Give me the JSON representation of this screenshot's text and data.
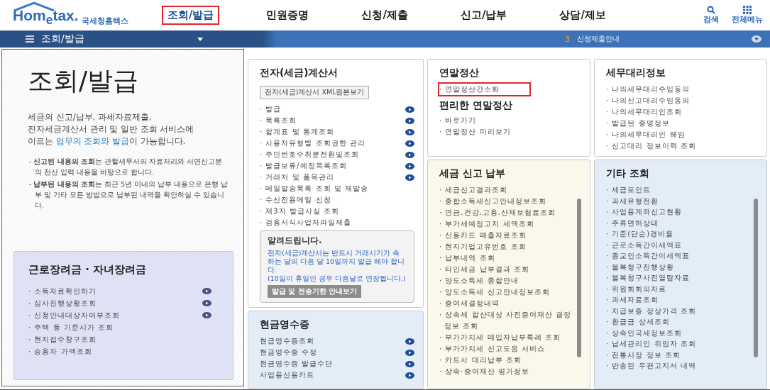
{
  "header": {
    "logo": "Hom$_{e}$tax.",
    "brand": "국세청홈택스",
    "nav": [
      {
        "label": "조회/발급",
        "selected": true
      },
      {
        "label": "민원증명",
        "selected": false
      },
      {
        "label": "신청/제출",
        "selected": false
      },
      {
        "label": "신고/납부",
        "selected": false
      },
      {
        "label": "상담/제보",
        "selected": false
      }
    ],
    "tools": [
      {
        "kind": "search",
        "label": "검색"
      },
      {
        "kind": "menu",
        "label": "전체메뉴"
      }
    ]
  },
  "subbar": {
    "title": "조회/발급",
    "count": "3",
    "notice": "신청제출안내"
  },
  "intro": {
    "title": "조회/발급",
    "before": "세금의 신고/납부, 과세자료제출,\n전자세금계산서 관리 및 일반 조회 서비스에\n이르는 ",
    "highlight": "업무의 조회와 발급",
    "after": "이 가능합니다.",
    "notes": [
      "- **신고된 내용의 조회**는 관할세무서의 자료처리와 서면신고분의 전산 입력 내용을 바탕으로 합니다.",
      "- **납부된 내용의 조회**는 최근 5년 이내의 납부 내용으로 은행 납부 및 기타 모든 방법으로 납부된 내역을 확인하실 수 있습니다."
    ]
  },
  "incentive": {
    "title": "근로장려금 · 자녀장려금",
    "items": [
      {
        "label": "· 소득자료확인하기",
        "arrow": true
      },
      {
        "label": "· 심사진행상황조회",
        "arrow": true
      },
      {
        "label": "· 신청안내대상자여부조회",
        "arrow": true
      },
      {
        "label": "· 주택 등 기준시가 조회",
        "arrow": false
      },
      {
        "label": "· 현지접수창구조회",
        "arrow": false
      },
      {
        "label": "· 승용차 가액조회",
        "arrow": false
      }
    ]
  },
  "einvoice": {
    "title": "전자(세금)계산서",
    "xml_button": "전자(세금)계산서 XML원본보기",
    "items": [
      {
        "label": "· 발급",
        "arrow": true
      },
      {
        "label": "· 목록조회",
        "arrow": true
      },
      {
        "label": "· 합계표 및 통계조회",
        "arrow": true
      },
      {
        "label": "· 사용자유형별 조회권한 관리",
        "arrow": true
      },
      {
        "label": "· 주민번호수취분전환및조회",
        "arrow": true
      },
      {
        "label": "· 발급보류/예정목록조회",
        "arrow": true
      },
      {
        "label": "· 거래처 및 품목관리",
        "arrow": true
      },
      {
        "label": "· 메일발송목록 조회 및 재발송",
        "arrow": false
      },
      {
        "label": "· 수신전용메일 신청",
        "arrow": false
      },
      {
        "label": "· 제3자 발급사실 조회",
        "arrow": false
      },
      {
        "label": "· 검용서식사업자파일제출",
        "arrow": false
      }
    ],
    "notice": {
      "title": "알려드립니다.",
      "body": "전자(세금)계산서는 반드시 거래시기가 속하는 달의 다음 달 10일까지 발급 해야 합니다.",
      "note": "(10일이 휴일인 경우 다음날로 연장됩니다.)",
      "button": "발급 및 전송기한 안내보기"
    }
  },
  "cash_receipt": {
    "title": "현금영수증",
    "items": [
      {
        "label": "현금영수증조회",
        "arrow": true
      },
      {
        "label": "현금영수증 수정",
        "arrow": true
      },
      {
        "label": "현금영수증 발급수단",
        "arrow": true
      },
      {
        "label": "사업용신용카드",
        "arrow": true
      }
    ]
  },
  "year_end": {
    "title": "연말정산",
    "items": [
      {
        "label": "· 연말정산간소화",
        "highlighted": true
      }
    ],
    "subtitle": "편리한 연말정산",
    "sub_items": [
      {
        "label": "· 바로가기",
        "highlighted": false
      },
      {
        "label": "· 연말정산 미리보기",
        "highlighted": false
      }
    ]
  },
  "tax_filing": {
    "title": "세금 신고 납부",
    "items": [
      "· 세금신고결과조회",
      "· 종합소득세신고안내정보조회",
      "· 연금.건강.고용.산재보험료조회",
      "· 부가세예정고지 세액조회",
      "· 신용카드 매출자료조회",
      "· 현지기업고유번호 조회",
      "· 납부내역 조회",
      "· 타인세금 납부결과 조회",
      "· 양도소득세 종합안내",
      "· 양도소득세 신고안내정보조회",
      "· 증여세결정내역",
      "· 상속세 합산대상 사전증여재산 결정정보 조회",
      "· 부가가치세 매입자납부특례 조회",
      "· 부가가치세 신고도움 서비스",
      "· 카드사 대리납부 조회",
      "· 상속·증여재산 평가정보"
    ]
  },
  "agent_info": {
    "title": "세무대리정보",
    "items": [
      "· 나의세무대리수임동의",
      "· 나의신고대리수임동의",
      "· 나의세무대리인조회",
      "· 발급된 증명정보",
      "· 나의세무대리인 해임",
      "· 신고대리 정보이력 조회"
    ]
  },
  "other": {
    "title": "기타 조회",
    "items": [
      "· 세금포인트",
      "· 과세유형전환",
      "· 사업용계좌신고현황",
      "· 주류면허상태",
      "· 기준(단순)경비율",
      "· 근로소득간이세액표",
      "· 종교인소득간이세액표",
      "· 불복청구진행상황",
      "· 불복청구사전열람자료",
      "· 위원회회의자료",
      "· 과세자료조회",
      "· 지급보증 정상가격 조회",
      "· 환급금 상세조회",
      "· 상속인국세정보조회",
      "· 납세관리인 위임자 조회",
      "· 전통시장 정보 조회",
      "· 반송된 우편고지서 내역"
    ]
  }
}
